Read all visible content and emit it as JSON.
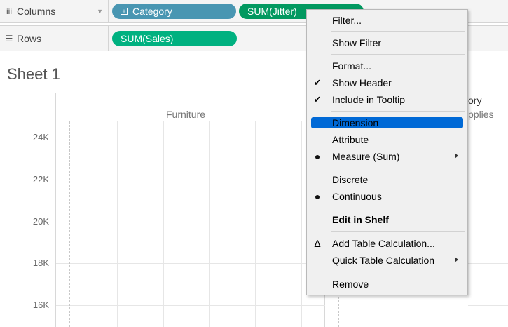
{
  "shelves": {
    "columns": {
      "label": "Columns",
      "icon": "columns-icon",
      "pills": [
        {
          "text": "Category",
          "color": "#4996b2"
        },
        {
          "text": "SUM(Jitter)",
          "color": "#029960"
        }
      ]
    },
    "rows": {
      "label": "Rows",
      "icon": "rows-icon",
      "pills": [
        {
          "text": "SUM(Sales)",
          "color": "#00b180"
        }
      ]
    }
  },
  "sheet": {
    "title": "Sheet 1",
    "column_headers": [
      "Furniture",
      "ory",
      "pplies"
    ],
    "y_ticks": [
      "24K",
      "22K",
      "20K",
      "18K",
      "16K"
    ]
  },
  "context_menu": {
    "items": [
      {
        "label": "Filter..."
      },
      {
        "label": "Show Filter"
      },
      {
        "label": "Format..."
      },
      {
        "label": "Show Header",
        "mark": "check"
      },
      {
        "label": "Include in Tooltip",
        "mark": "check"
      },
      {
        "label": "Dimension",
        "highlighted": true
      },
      {
        "label": "Attribute"
      },
      {
        "label": "Measure (Sum)",
        "mark": "bullet",
        "submenu": true
      },
      {
        "label": "Discrete"
      },
      {
        "label": "Continuous",
        "mark": "bullet"
      },
      {
        "label": "Edit in Shelf",
        "bold": true
      },
      {
        "label": "Add Table Calculation...",
        "mark": "delta"
      },
      {
        "label": "Quick Table Calculation",
        "submenu": true
      },
      {
        "label": "Remove"
      }
    ],
    "highlight_color": "#0069d6"
  }
}
